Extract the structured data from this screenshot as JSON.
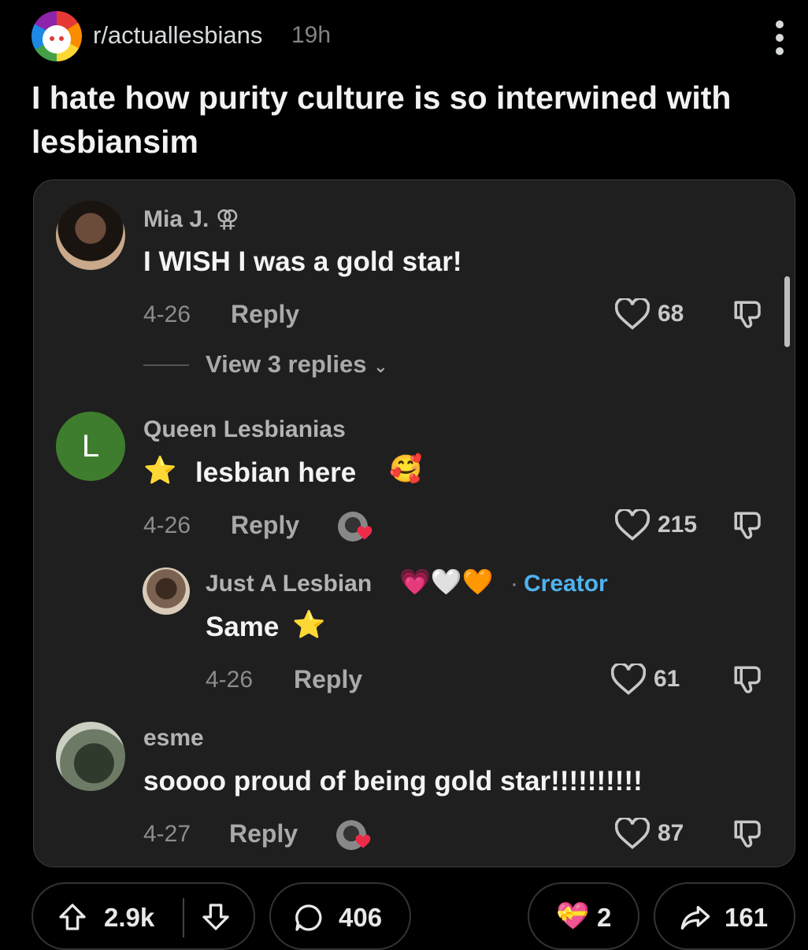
{
  "header": {
    "subreddit": "r/actuallesbians",
    "time": "19h"
  },
  "post": {
    "title": "I hate how purity culture is so interwined with lesbiansim"
  },
  "comments": [
    {
      "author": "Mia J. ⚢",
      "text": "I WISH I was a gold star!",
      "date": "4-26",
      "reply_label": "Reply",
      "likes": "68",
      "view_replies": "View 3 replies"
    },
    {
      "author": "Queen Lesbianias",
      "avatar_letter": "L",
      "text": "lesbian here",
      "date": "4-26",
      "reply_label": "Reply",
      "likes": "215"
    },
    {
      "author": "Just A Lesbian",
      "creator_badge": "Creator",
      "text": "Same",
      "date": "4-26",
      "reply_label": "Reply",
      "likes": "61"
    },
    {
      "author": "esme",
      "text": "soooo proud of being gold star!!!!!!!!!!",
      "date": "4-27",
      "reply_label": "Reply",
      "likes": "87"
    }
  ],
  "actions": {
    "upvotes": "2.9k",
    "comments": "406",
    "awards": "2",
    "shares": "161"
  },
  "icons": {
    "star": "⭐",
    "smiling_hearts": "🥰",
    "hearts": "💗🤍🧡",
    "award": "💝"
  },
  "colors": {
    "accent": "#4fb3f0",
    "background": "#000000",
    "card": "#1f1f1f"
  }
}
